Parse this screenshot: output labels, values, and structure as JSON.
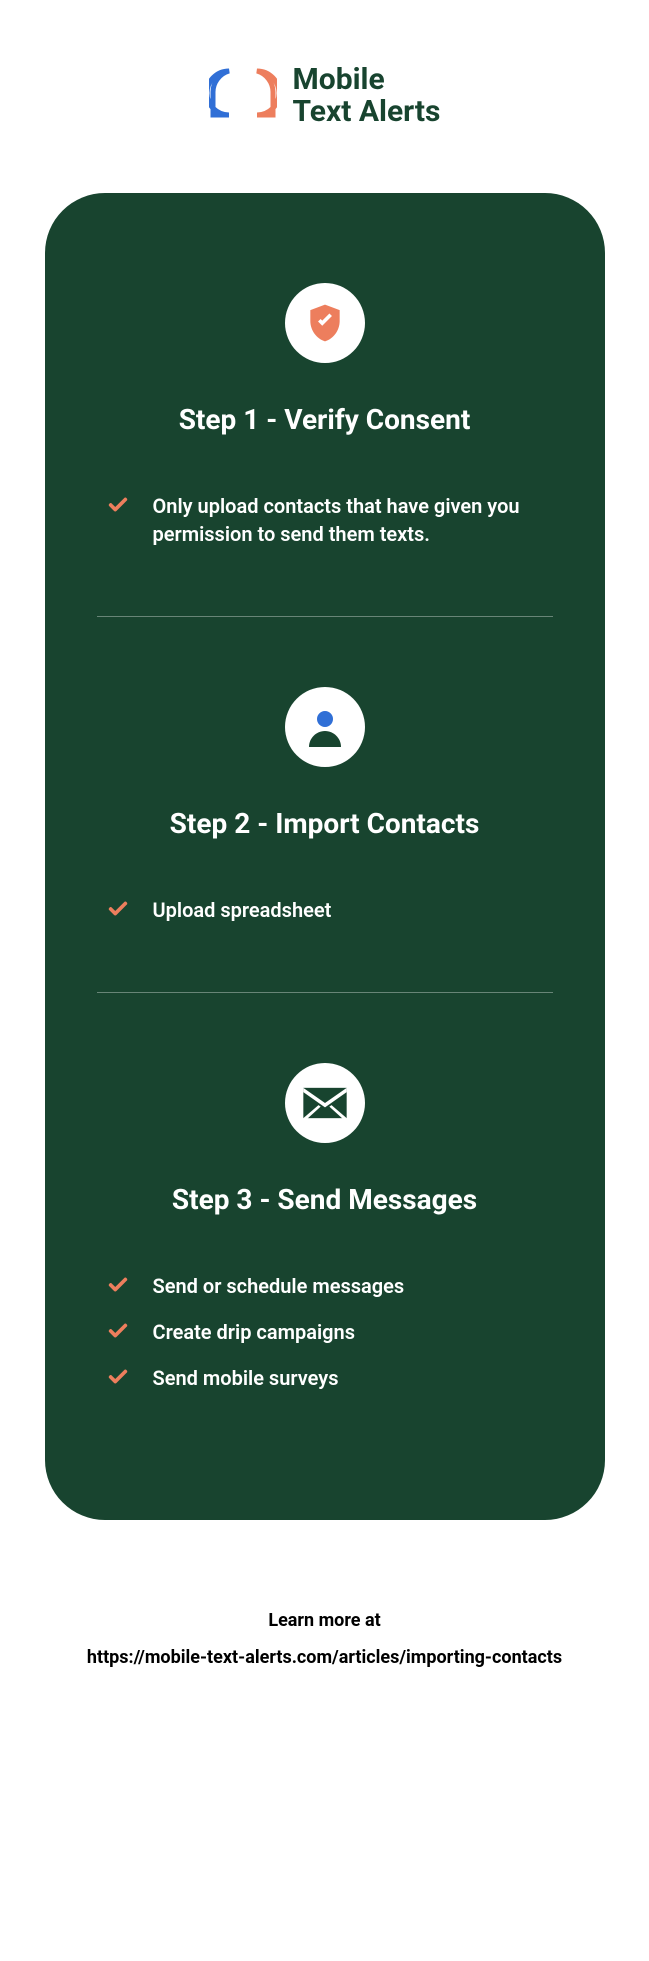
{
  "logo": {
    "line1": "Mobile",
    "line2": "Text Alerts"
  },
  "steps": [
    {
      "title": "Step 1 - Verify Consent",
      "items": [
        "Only upload contacts that have given you permission to send them texts."
      ]
    },
    {
      "title": "Step 2 - Import Contacts",
      "items": [
        "Upload spreadsheet"
      ]
    },
    {
      "title": "Step 3 - Send Messages",
      "items": [
        "Send or schedule messages",
        "Create drip campaigns",
        "Send mobile surveys"
      ]
    }
  ],
  "footer": {
    "line1": "Learn more at",
    "line2": "https://mobile-text-alerts.com/articles/importing-contacts"
  }
}
